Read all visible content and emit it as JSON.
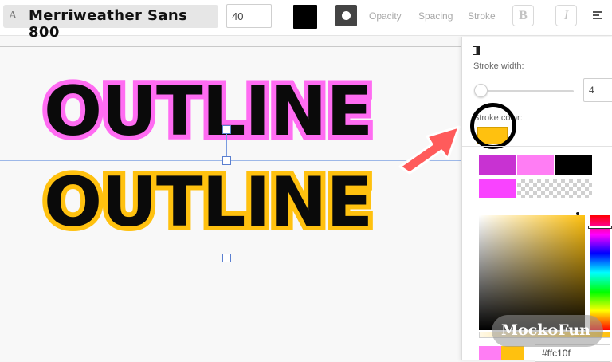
{
  "toolbar": {
    "font_icon": "A",
    "font_name": "Merriweather Sans 800",
    "font_size": "40",
    "text_color": "#000000",
    "tabs": {
      "opacity": "Opacity",
      "spacing": "Spacing",
      "stroke": "Stroke"
    },
    "bold_label": "B",
    "italic_label": "I"
  },
  "canvas": {
    "text_line_1": "OUTLINE",
    "text_line_2": "OUTLINE",
    "stroke_color_1": "#ff6cf2",
    "stroke_color_2": "#ffc10f"
  },
  "stroke_panel": {
    "stroke_width_label": "Stroke width:",
    "stroke_width_value": "4",
    "stroke_color_label": "Stroke color:",
    "stroke_color": "#ffc10f",
    "preset_colors": [
      "#c832d2",
      "#ff7df4",
      "#000000",
      "#f943ff",
      "transparent"
    ],
    "hex_value": "#ffc10f"
  },
  "watermark": {
    "text": "MockoFun"
  }
}
